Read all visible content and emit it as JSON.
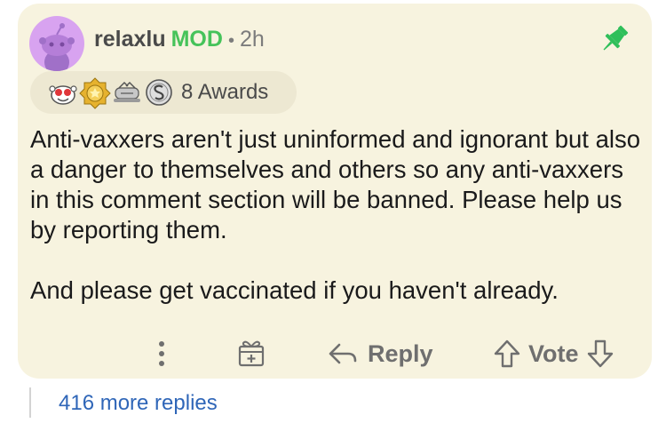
{
  "comment": {
    "username": "relaxlu",
    "mod_badge": "MOD",
    "separator": "•",
    "time": "2h",
    "awards_label": "8 Awards",
    "paragraphs": [
      "Anti-vaxxers aren't just uninformed and ignorant but also a danger to themselves and others so any anti-vaxxers in this comment section will be banned. Please help us by reporting them.",
      "And please get vaccinated if you haven't already."
    ],
    "actions": {
      "reply_label": "Reply",
      "vote_label": "Vote"
    },
    "more_replies": "416 more replies"
  },
  "colors": {
    "card_bg": "#f7f3df",
    "mod_green": "#46c35a",
    "link_blue": "#2f66b8",
    "avatar_bg": "#d8a3f0",
    "pin_green": "#2fbf5a"
  },
  "icons": [
    "snoo-avatar-icon",
    "pin-icon",
    "award-wholesome-icon",
    "award-gold-icon",
    "award-helpful-icon",
    "award-silver-icon",
    "more-options-icon",
    "gift-icon",
    "reply-arrow-icon",
    "upvote-icon",
    "downvote-icon"
  ]
}
